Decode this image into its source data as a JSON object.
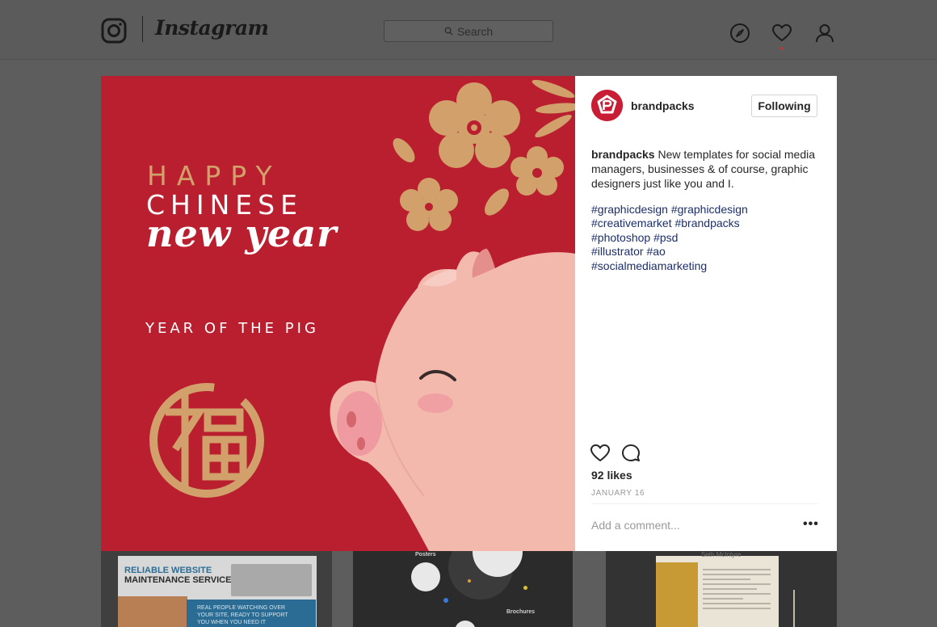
{
  "header": {
    "logo_text": "Instagram",
    "search_placeholder": "Search",
    "icons": [
      "instagram-camera-icon",
      "search-icon",
      "compass-icon",
      "heart-icon",
      "profile-icon"
    ]
  },
  "post": {
    "image_text": {
      "happy": "HAPPY",
      "chinese": "CHINESE",
      "new_year": "new year",
      "year_of_pig": "YEAR OF THE PIG"
    },
    "username": "brandpacks",
    "follow_label": "Following",
    "caption_user": "brandpacks",
    "caption_text": " New templates for social media managers, businesses & of course, graphic designers just like you and I.",
    "hashtags": [
      "#graphicdesign #graphicdesign",
      "#creativemarket #brandpacks",
      "#photoshop #psd",
      "#illustrator #ao",
      "#socialmediamarketing"
    ],
    "likes": "92 likes",
    "date": "JANUARY 16",
    "comment_placeholder": "Add a comment...",
    "more_label": "•••"
  },
  "thumbnails": {
    "first": {
      "title_1": "RELIABLE WEBSITE",
      "title_2": "MAINTENANCE SERVICES",
      "body": [
        "REAL PEOPLE WATCHING OVER",
        "YOUR SITE, READY TO SUPPORT",
        "YOU WHEN YOU NEED IT"
      ]
    },
    "second": {
      "label_top": "Posters",
      "label_bottom": "Brochures"
    },
    "third": {
      "name": "Seth McIntyre"
    }
  },
  "colors": {
    "brand_red": "#b91f2f",
    "gold": "#d1a06b",
    "pig_pink": "#f3b9ad",
    "hashtag": "#1c2f6b"
  }
}
